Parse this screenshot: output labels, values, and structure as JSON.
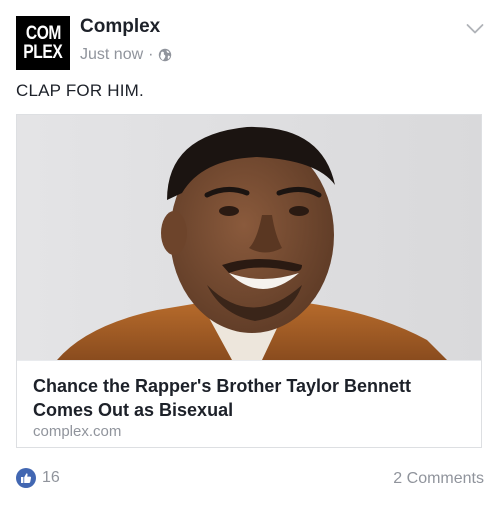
{
  "header": {
    "logo_line1": "COM",
    "logo_line2": "PLEX",
    "page_name": "Complex",
    "timestamp": "Just now",
    "separator": "·",
    "privacy_icon": "globe-icon",
    "menu_icon": "chevron-down-icon"
  },
  "post": {
    "text": "CLAP FOR HIM."
  },
  "link_card": {
    "image": "portrait-photo",
    "title": "Chance the Rapper's Brother Taylor Bennett Comes Out as Bisexual",
    "domain": "complex.com"
  },
  "footer": {
    "like_icon": "thumbs-up-icon",
    "like_count": "16",
    "comments": "2 Comments"
  },
  "colors": {
    "accent": "#4267b2",
    "muted_text": "#90949c",
    "text": "#1d2129"
  }
}
